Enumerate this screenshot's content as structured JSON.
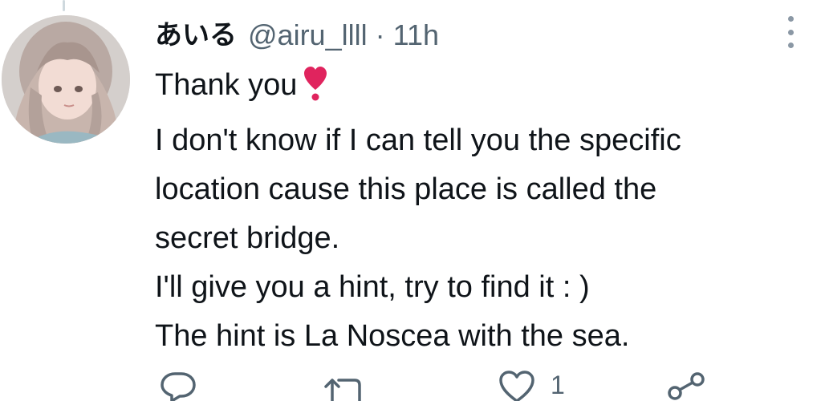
{
  "tweet": {
    "display_name": "あいる",
    "handle": "@airu_llll",
    "separator": "·",
    "time": "11h",
    "lines": [
      "Thank you",
      "I don't know if I can tell you the specific",
      "location cause this place is called the",
      "secret bridge.",
      "I'll give you a hint, try to find it : )",
      "The hint is La Noscea with the sea."
    ],
    "emoji": "heavy-heart-exclamation"
  },
  "actions": {
    "reply_icon": "reply-icon",
    "retweet_icon": "retweet-icon",
    "like_icon": "like-icon",
    "like_count": "1",
    "share_icon": "share-icon"
  },
  "colors": {
    "text": "#0f1419",
    "secondary": "#536471",
    "heart": "#e0245e"
  }
}
